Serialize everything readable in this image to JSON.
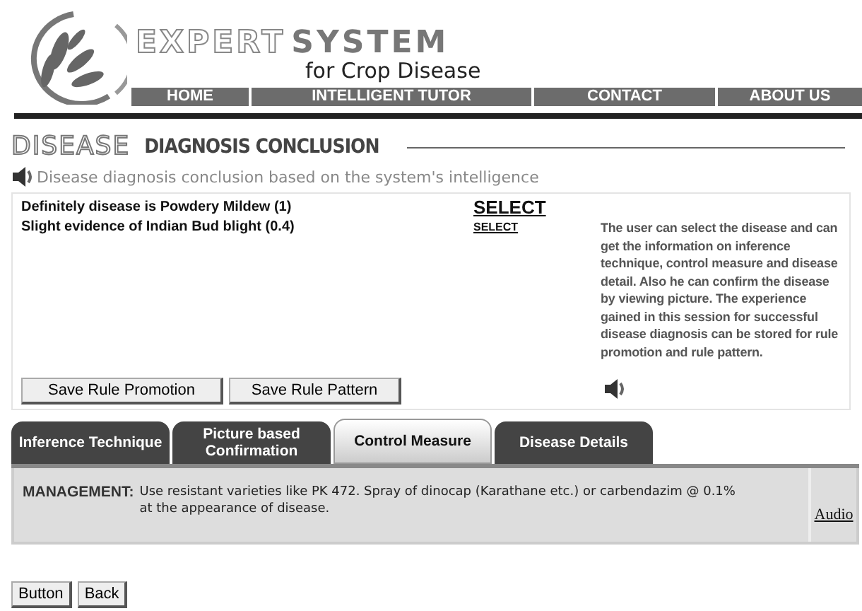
{
  "header": {
    "title_light": "EXPERT",
    "title_bold": "SYSTEM",
    "subtitle": "for Crop Disease"
  },
  "nav": [
    "HOME",
    "INTELLIGENT TUTOR",
    "CONTACT",
    "ABOUT US"
  ],
  "section": {
    "title_light": "DISEASE",
    "title_bold": "DIAGNOSIS CONCLUSION",
    "subtitle": "Disease diagnosis conclusion based on the system's intelligence"
  },
  "results": [
    {
      "text": "Definitely disease is Powdery Mildew (1)",
      "link": "SELECT",
      "kind": "primary"
    },
    {
      "text": "Slight evidence of Indian Bud blight (0.4)",
      "link": "SELECT",
      "kind": "secondary"
    }
  ],
  "help_text": "The user can select the disease and can get the information on inference technique, control measure and disease detail. Also he can confirm the disease by viewing picture. The experience gained in this session for successful disease diagnosis can be stored for rule promotion and rule pattern.",
  "save_buttons": [
    "Save Rule Promotion",
    "Save Rule Pattern"
  ],
  "tabs": [
    {
      "label": "Inference Technique",
      "selected": false
    },
    {
      "label": "Picture based Confirmation",
      "selected": false
    },
    {
      "label": "Control Measure",
      "selected": true
    },
    {
      "label": "Disease Details",
      "selected": false
    }
  ],
  "panel": {
    "label": "MANAGEMENT:",
    "text": "Use resistant varieties like PK 472. Spray of dinocap (Karathane etc.) or carbendazim @ 0.1% at the appearance of disease.",
    "link": "Audio"
  },
  "footer_buttons": [
    "Button",
    "Back"
  ]
}
